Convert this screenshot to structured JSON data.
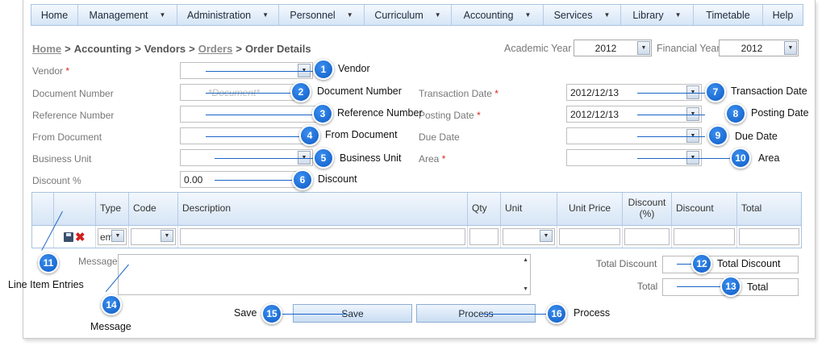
{
  "menu": [
    "Home",
    "Management",
    "Administration",
    "Personnel",
    "Curriculum",
    "Accounting",
    "Services",
    "Library",
    "Timetable",
    "Help"
  ],
  "breadcrumb": {
    "home": "Home",
    "accounting": "Accounting",
    "vendors": "Vendors",
    "orders": "Orders",
    "current": "Order Details"
  },
  "academic_year": {
    "label": "Academic Year",
    "value": "2012"
  },
  "financial_year": {
    "label": "Financial Year",
    "value": "2012"
  },
  "form": {
    "vendor_label": "Vendor",
    "document_number_label": "Document Number",
    "document_number_placeholder": "*Document*",
    "reference_number_label": "Reference Number",
    "from_document_label": "From Document",
    "business_unit_label": "Business Unit",
    "discount_label": "Discount %",
    "discount_value": "0.00",
    "transaction_date_label": "Transaction Date",
    "transaction_date_value": "2012/12/13",
    "posting_date_label": "Posting Date",
    "posting_date_value": "2012/12/13",
    "due_date_label": "Due Date",
    "area_label": "Area",
    "required_mark": "*"
  },
  "grid": {
    "headers": [
      "Type",
      "Code",
      "Description",
      "Qty",
      "Unit",
      "Unit Price",
      "Discount (%)",
      "Discount",
      "Total"
    ],
    "type_value": "em"
  },
  "bottom": {
    "message_label": "Message",
    "total_discount_label": "Total Discount",
    "total_label": "Total",
    "save_label": "Save",
    "process_label": "Process"
  },
  "callouts": [
    {
      "num": "1",
      "text": "Vendor"
    },
    {
      "num": "2",
      "text": "Document Number"
    },
    {
      "num": "3",
      "text": "Reference Number"
    },
    {
      "num": "4",
      "text": "From Document"
    },
    {
      "num": "5",
      "text": "Business Unit"
    },
    {
      "num": "6",
      "text": "Discount"
    },
    {
      "num": "7",
      "text": "Transaction Date"
    },
    {
      "num": "8",
      "text": "Posting Date"
    },
    {
      "num": "9",
      "text": "Due Date"
    },
    {
      "num": "10",
      "text": "Area"
    },
    {
      "num": "11",
      "text": "Line Item Entries"
    },
    {
      "num": "12",
      "text": "Total Discount"
    },
    {
      "num": "13",
      "text": "Total"
    },
    {
      "num": "14",
      "text": "Message"
    },
    {
      "num": "15",
      "text": "Save"
    },
    {
      "num": "16",
      "text": "Process"
    }
  ],
  "colors": {
    "accent": "#1a66c7",
    "required": "#d9251d",
    "menu_bg": "#d5e5f6"
  }
}
